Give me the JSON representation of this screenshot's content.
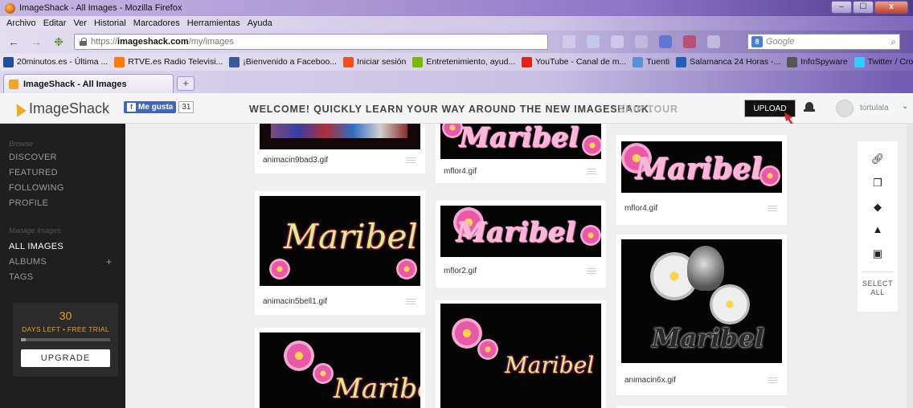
{
  "window": {
    "title": "ImageShack - All Images - Mozilla Firefox",
    "controls": [
      "–",
      "☐",
      "x"
    ]
  },
  "menu": [
    "Archivo",
    "Editar",
    "Ver",
    "Historial",
    "Marcadores",
    "Herramientas",
    "Ayuda"
  ],
  "address": {
    "url_prefix": "https://",
    "url_host": "imageshack.com",
    "url_path": "/my/images"
  },
  "search": {
    "engine_icon": "8",
    "placeholder": "Google"
  },
  "bookmarks": [
    {
      "label": "20minutos.es - Última ...",
      "color": "#1f4e9c"
    },
    {
      "label": "RTVE.es Radio Televisi...",
      "color": "#ff7a00"
    },
    {
      "label": "¡Bienvenido a Faceboo...",
      "color": "#3b5998"
    },
    {
      "label": "Iniciar sesión",
      "color": "#f25022"
    },
    {
      "label": "Entretenimiento, ayud...",
      "color": "#7ab800"
    },
    {
      "label": "YouTube - Canal de m...",
      "color": "#e62117"
    },
    {
      "label": "Tuenti",
      "color": "#5a8fd0"
    },
    {
      "label": "Salamanca 24 Horas -...",
      "color": "#1f5fb8"
    },
    {
      "label": "InfoSpyware",
      "color": "#555555"
    },
    {
      "label": "Twitter / Cronología",
      "color": "#33ccff"
    }
  ],
  "tab": {
    "label": "ImageShack - All Images",
    "new_tab": "+"
  },
  "header": {
    "logo": "ImageShack",
    "fb_like": "Me gusta",
    "fb_count": "31",
    "welcome": "WELCOME! QUICKLY LEARN YOUR WAY AROUND THE NEW IMAGESHACK.",
    "skip": "SKIP TOUR",
    "upload": "UPLOAD",
    "username": "tortulala"
  },
  "sidebar": {
    "browse_label": "Browse",
    "browse_items": [
      "DISCOVER",
      "FEATURED",
      "FOLLOWING",
      "PROFILE"
    ],
    "manage_label": "Manage Images",
    "manage_items": [
      "ALL IMAGES",
      "ALBUMS",
      "TAGS"
    ],
    "active_item": "ALL IMAGES",
    "albums_plus": "+",
    "trial": {
      "days": "30",
      "text": "DAYS LEFT • FREE TRIAL",
      "upgrade": "UPGRADE",
      "progress": 0.05
    }
  },
  "images": {
    "col1": [
      "animacin9bad3.gif",
      "animacin5bell1.gif"
    ],
    "col2": [
      "mflor4.gif",
      "mflor2.gif"
    ],
    "col3": [
      "mflor4.gif",
      "animacin6x.gif"
    ]
  },
  "image_text": {
    "maribel_pink": "Maribel",
    "maribel_script": "Maribel",
    "maribel_white": "Maribel"
  },
  "rail": {
    "icons": [
      "link-icon",
      "copy-icon",
      "tag-icon",
      "lock-icon",
      "trash-icon"
    ],
    "select_all": "SELECT ALL"
  },
  "colors": {
    "accent": "#f2a91c",
    "sidebar_bg": "#1f1f1f",
    "upload_bg": "#111111",
    "trial_text": "#e8a020"
  }
}
